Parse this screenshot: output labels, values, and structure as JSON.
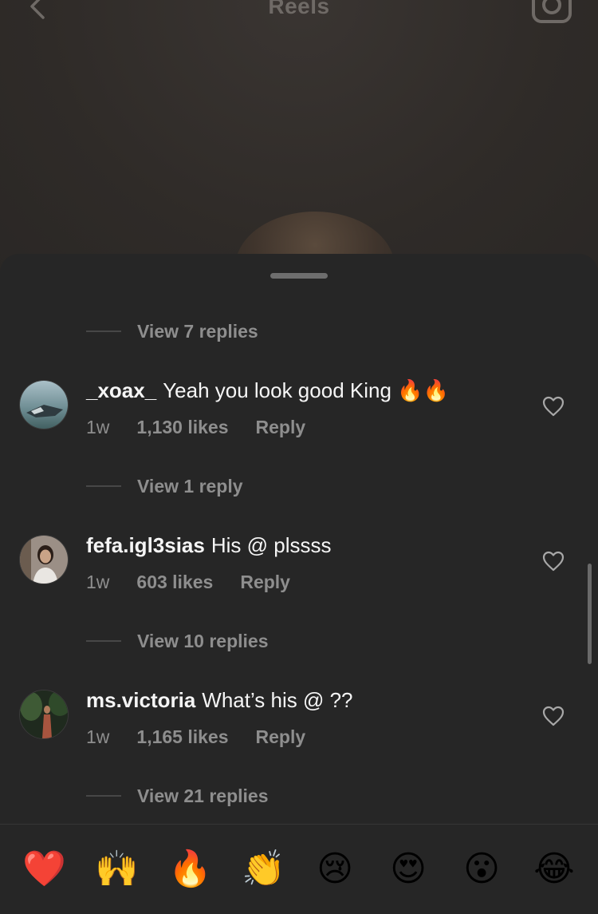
{
  "header": {
    "title": "Reels"
  },
  "threads": [
    {
      "view_replies": "View 7 replies"
    },
    {
      "username": "_xoax_",
      "text": "Yeah you look good King 🔥🔥",
      "time": "1w",
      "likes": "1,130 likes",
      "reply": "Reply",
      "view_replies": "View 1 reply"
    },
    {
      "username": "fefa.igl3sias",
      "text": "His @ plssss",
      "time": "1w",
      "likes": "603 likes",
      "reply": "Reply",
      "view_replies": "View 10 replies"
    },
    {
      "username": "ms.victoria",
      "text": "What’s his @ ??",
      "time": "1w",
      "likes": "1,165 likes",
      "reply": "Reply",
      "view_replies": "View 21 replies"
    }
  ],
  "emoji_bar": [
    "❤️",
    "🙌",
    "🔥",
    "👏",
    "😢",
    "😍",
    "😮",
    "😂"
  ],
  "icons": {
    "back": "chevron-left-icon",
    "camera": "camera-icon",
    "like": "heart-outline-icon"
  },
  "colors": {
    "sheet_bg": "#262626",
    "primary_text": "#f5f5f5",
    "secondary_text": "#8e8e8e"
  }
}
